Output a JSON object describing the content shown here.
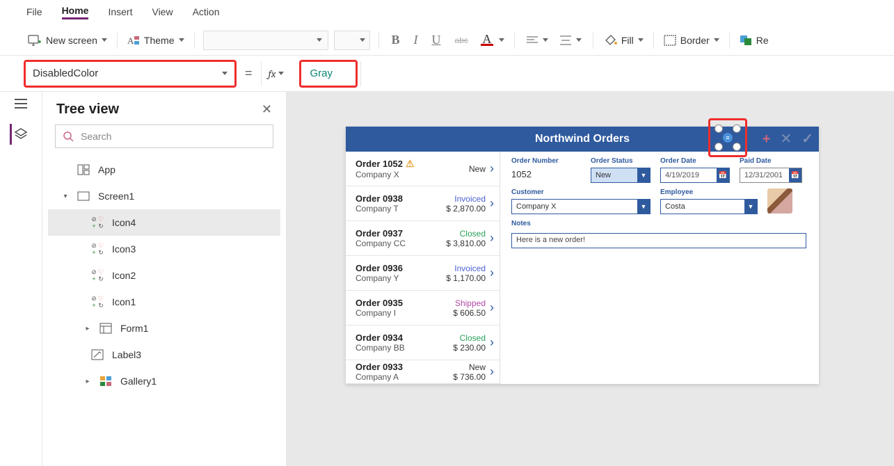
{
  "menu": {
    "file": "File",
    "home": "Home",
    "insert": "Insert",
    "view": "View",
    "action": "Action"
  },
  "toolbar": {
    "newScreen": "New screen",
    "theme": "Theme",
    "fill": "Fill",
    "border": "Border",
    "reorder": "Re"
  },
  "formula": {
    "property": "DisabledColor",
    "value": "Gray"
  },
  "tree": {
    "title": "Tree view",
    "searchPlaceholder": "Search",
    "app": "App",
    "screen": "Screen1",
    "items": [
      "Icon4",
      "Icon3",
      "Icon2",
      "Icon1",
      "Form1",
      "Label3",
      "Gallery1"
    ]
  },
  "app": {
    "title": "Northwind Orders",
    "orders": [
      {
        "title": "Order 1052",
        "company": "Company X",
        "status": "New",
        "statusClass": "st-new",
        "amount": "",
        "warn": true
      },
      {
        "title": "Order 0938",
        "company": "Company T",
        "status": "Invoiced",
        "statusClass": "st-invoiced",
        "amount": "$ 2,870.00"
      },
      {
        "title": "Order 0937",
        "company": "Company CC",
        "status": "Closed",
        "statusClass": "st-closed",
        "amount": "$ 3,810.00"
      },
      {
        "title": "Order 0936",
        "company": "Company Y",
        "status": "Invoiced",
        "statusClass": "st-invoiced",
        "amount": "$ 1,170.00"
      },
      {
        "title": "Order 0935",
        "company": "Company I",
        "status": "Shipped",
        "statusClass": "st-shipped",
        "amount": "$ 606.50"
      },
      {
        "title": "Order 0934",
        "company": "Company BB",
        "status": "Closed",
        "statusClass": "st-closed",
        "amount": "$ 230.00"
      },
      {
        "title": "Order 0933",
        "company": "Company A",
        "status": "New",
        "statusClass": "st-new",
        "amount": "$ 736.00"
      }
    ],
    "detail": {
      "labels": {
        "orderNumber": "Order Number",
        "orderStatus": "Order Status",
        "orderDate": "Order Date",
        "paidDate": "Paid Date",
        "customer": "Customer",
        "employee": "Employee",
        "notes": "Notes"
      },
      "orderNumber": "1052",
      "orderStatus": "New",
      "orderDate": "4/19/2019",
      "paidDate": "12/31/2001",
      "customer": "Company X",
      "employee": "Costa",
      "notes": "Here is a new order!"
    }
  }
}
